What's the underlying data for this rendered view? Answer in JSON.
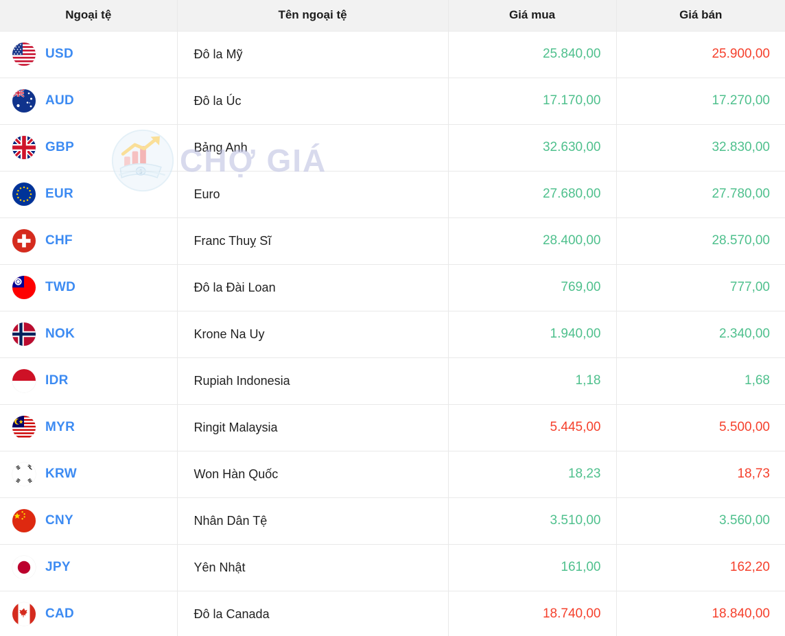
{
  "table": {
    "columns": [
      {
        "key": "code",
        "label": "Ngoại tệ"
      },
      {
        "key": "name",
        "label": "Tên ngoại tệ"
      },
      {
        "key": "buy",
        "label": "Giá mua"
      },
      {
        "key": "sell",
        "label": "Giá bán"
      }
    ],
    "rows": [
      {
        "code": "USD",
        "flag": "flag-us",
        "name": "Đô la Mỹ",
        "buy": "25.840,00",
        "buy_dir": "up",
        "sell": "25.900,00",
        "sell_dir": "down"
      },
      {
        "code": "AUD",
        "flag": "flag-au",
        "name": "Đô la Úc",
        "buy": "17.170,00",
        "buy_dir": "up",
        "sell": "17.270,00",
        "sell_dir": "up"
      },
      {
        "code": "GBP",
        "flag": "flag-gb",
        "name": "Bảng Anh",
        "buy": "32.630,00",
        "buy_dir": "up",
        "sell": "32.830,00",
        "sell_dir": "up"
      },
      {
        "code": "EUR",
        "flag": "flag-eu",
        "name": "Euro",
        "buy": "27.680,00",
        "buy_dir": "up",
        "sell": "27.780,00",
        "sell_dir": "up"
      },
      {
        "code": "CHF",
        "flag": "flag-ch",
        "name": "Franc Thuỵ Sĩ",
        "buy": "28.400,00",
        "buy_dir": "up",
        "sell": "28.570,00",
        "sell_dir": "up"
      },
      {
        "code": "TWD",
        "flag": "flag-tw",
        "name": "Đô la Đài Loan",
        "buy": "769,00",
        "buy_dir": "up",
        "sell": "777,00",
        "sell_dir": "up"
      },
      {
        "code": "NOK",
        "flag": "flag-no",
        "name": "Krone Na Uy",
        "buy": "1.940,00",
        "buy_dir": "up",
        "sell": "2.340,00",
        "sell_dir": "up"
      },
      {
        "code": "IDR",
        "flag": "flag-id",
        "name": "Rupiah Indonesia",
        "buy": "1,18",
        "buy_dir": "up",
        "sell": "1,68",
        "sell_dir": "up"
      },
      {
        "code": "MYR",
        "flag": "flag-my",
        "name": "Ringit Malaysia",
        "buy": "5.445,00",
        "buy_dir": "down",
        "sell": "5.500,00",
        "sell_dir": "down"
      },
      {
        "code": "KRW",
        "flag": "flag-kr",
        "name": "Won Hàn Quốc",
        "buy": "18,23",
        "buy_dir": "up",
        "sell": "18,73",
        "sell_dir": "down"
      },
      {
        "code": "CNY",
        "flag": "flag-cn",
        "name": "Nhân Dân Tệ",
        "buy": "3.510,00",
        "buy_dir": "up",
        "sell": "3.560,00",
        "sell_dir": "up"
      },
      {
        "code": "JPY",
        "flag": "flag-jp",
        "name": "Yên Nhật",
        "buy": "161,00",
        "buy_dir": "up",
        "sell": "162,20",
        "sell_dir": "down"
      },
      {
        "code": "CAD",
        "flag": "flag-ca",
        "name": "Đô la Canada",
        "buy": "18.740,00",
        "buy_dir": "down",
        "sell": "18.840,00",
        "sell_dir": "down"
      }
    ]
  },
  "watermark": {
    "text": "CHỢ GIÁ",
    "logo_icon": "chart-money-logo-icon"
  },
  "colors": {
    "code_blue": "#3d8bf2",
    "price_up_green": "#4fc08d",
    "price_down_red": "#f5402c",
    "header_bg": "#f2f2f2",
    "border": "#e9e9e9"
  }
}
